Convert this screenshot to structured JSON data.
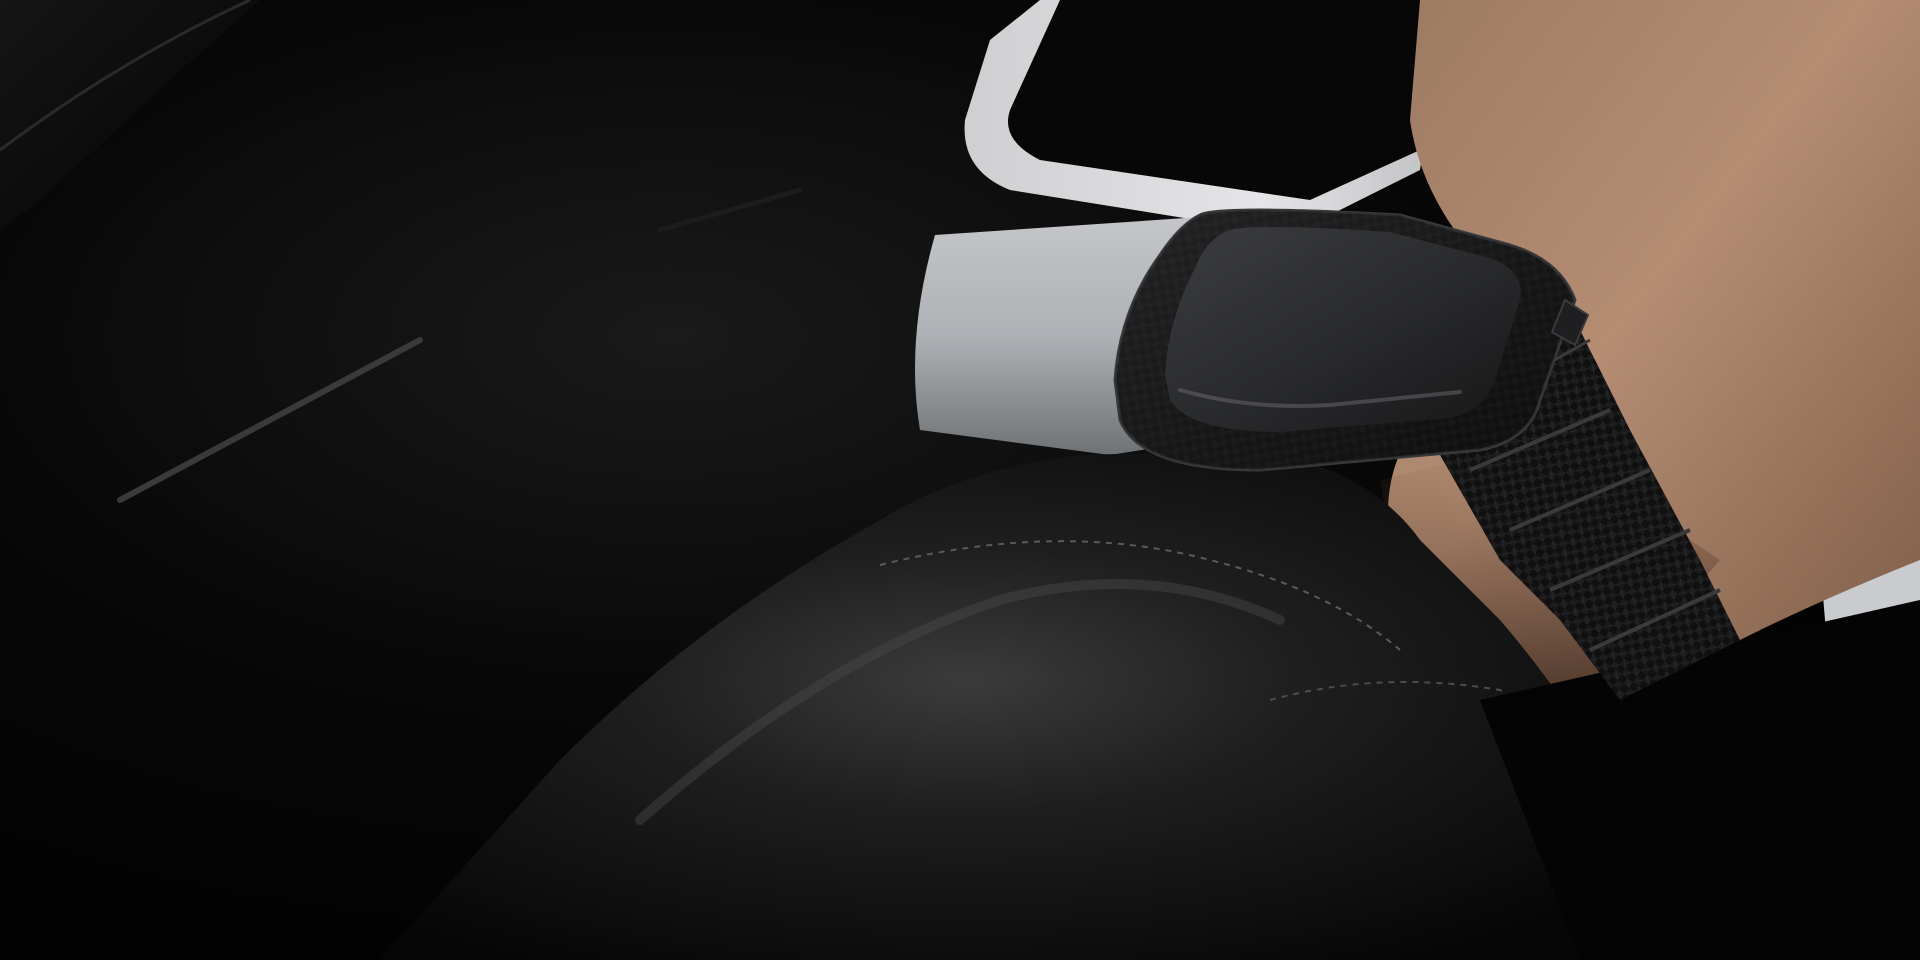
{
  "colors": {
    "background": "#050505",
    "dashboard_trim": "#d9d9db",
    "dashboard_panel": "#b9bcc0",
    "skin": "#a88068",
    "leather": "#151515",
    "carbon_band": "#111111",
    "watch_screen": "#2a2b2d"
  },
  "objects": {
    "background": "car-interior",
    "subject": "wrist-with-smartwatch",
    "watch_band": "carbon-fiber-link-band",
    "sleeve": "black-leather-jacket-sleeve"
  }
}
